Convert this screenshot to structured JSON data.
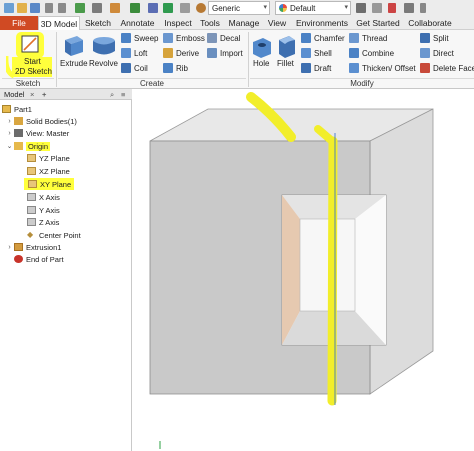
{
  "quick_access": {
    "material": "Generic",
    "appearance": "Default"
  },
  "tabs": [
    "File",
    "3D Model",
    "Sketch",
    "Annotate",
    "Inspect",
    "Tools",
    "Manage",
    "View",
    "Environments",
    "Get Started",
    "Collaborate"
  ],
  "ribbon": {
    "sketch_panel": {
      "button_line1": "Start",
      "button_line2": "2D Sketch",
      "title": "Sketch"
    },
    "create_panel": {
      "title": "Create",
      "large": [
        "Extrude",
        "Revolve"
      ],
      "col1": [
        "Sweep",
        "Loft",
        "Coil"
      ],
      "col2": [
        "Emboss",
        "Derive",
        "Rib"
      ],
      "col3": [
        "Decal",
        "Import"
      ]
    },
    "modify_panel": {
      "title": "Modify",
      "large": [
        "Hole",
        "Fillet"
      ],
      "col1": [
        "Chamfer",
        "Shell",
        "Draft"
      ],
      "col2": [
        "Thread",
        "Combine",
        "Thicken/ Offset"
      ],
      "col3": [
        "Split",
        "Direct",
        "Delete Face"
      ]
    }
  },
  "model_browser": {
    "tab_label": "Model",
    "close_glyph": "×",
    "add_glyph": "+",
    "menu_glyph": "≡",
    "search_glyph": "⌕",
    "items": {
      "part": "Part1",
      "solid_bodies": "Solid Bodies(1)",
      "view": "View: Master",
      "origin": "Origin",
      "yz": "YZ Plane",
      "xz": "XZ Plane",
      "xy": "XY Plane",
      "x_axis": "X Axis",
      "y_axis": "Y Axis",
      "z_axis": "Z Axis",
      "center": "Center Point",
      "extrusion": "Extrusion1",
      "end": "End of Part"
    }
  },
  "colors": {
    "file_tab": "#d04a23",
    "highlight": "#ffff3c",
    "ribbon_icon_blue": "#3e7fc1",
    "body_front": "#c9c9c9",
    "body_side": "#dcdcdc",
    "body_top": "#e8e8e8"
  }
}
